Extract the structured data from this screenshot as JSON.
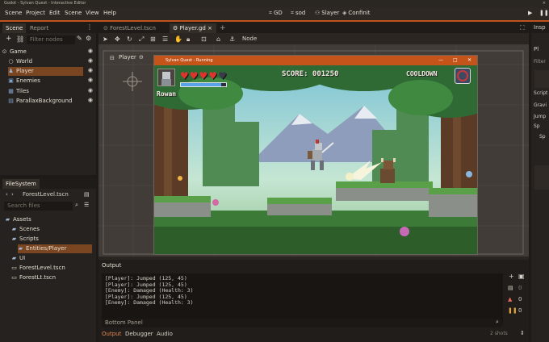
{
  "window": {
    "title": "Godot - Sylvan Quest - Interactive Editor",
    "close": "×"
  },
  "menu": [
    "Scene",
    "Project",
    "Edit",
    "Scene",
    "View",
    "Help"
  ],
  "topbar": {
    "b1": "GD",
    "b2": "sod",
    "b3": "Slayer",
    "b4": "Confinit"
  },
  "scene_dock": {
    "tabs": [
      "Scene",
      "Report"
    ],
    "filter_placeholder": "Filter nodes",
    "tree": [
      "Game",
      "World",
      "Player",
      "Enemies",
      "Tiles",
      "ParallaxBackground"
    ]
  },
  "filesystem": {
    "tab": "FileSystem",
    "path": "ForestLevel.tscn",
    "search_placeholder": "Search files",
    "items": [
      "Assets",
      "Scenes",
      "Scripts",
      "Entities/Player",
      "UI",
      "ForestLevel.tscn",
      "ForestLt.tscn"
    ]
  },
  "editor_tabs": [
    "ForestLevel.tscn",
    "Player.gd"
  ],
  "toolbar": {
    "node_label": "Node"
  },
  "viewport": {
    "player_label": "Player"
  },
  "game": {
    "title": "Sylvan Quest - Running",
    "score_label": "SCORE: 001250",
    "cooldown_label": "COOLDOWN",
    "player_name": "Rowan",
    "hearts_full": 4,
    "hearts_total": 5,
    "mana_fraction": 0.9
  },
  "output": {
    "title": "Output",
    "lines": [
      "[Player]: Jumped (125, 45)",
      "[Player]: Jumped (125, 45)",
      "[Enemy]: Damaged (Health: 3)",
      "[Player]: Jumped (125, 45)",
      "[Enemy]: Damaged (Health: 3)"
    ],
    "counts": [
      "0",
      "0",
      "0"
    ],
    "filter_label": "Bottom Panel",
    "tabs": [
      "Output",
      "Debugger",
      "Audio"
    ],
    "status": "2 shots"
  },
  "inspector": {
    "tab": "Insp",
    "items": [
      "Pl",
      "Filter",
      "Script",
      "Gravi",
      "Jump",
      "Sp",
      "Sp"
    ]
  }
}
